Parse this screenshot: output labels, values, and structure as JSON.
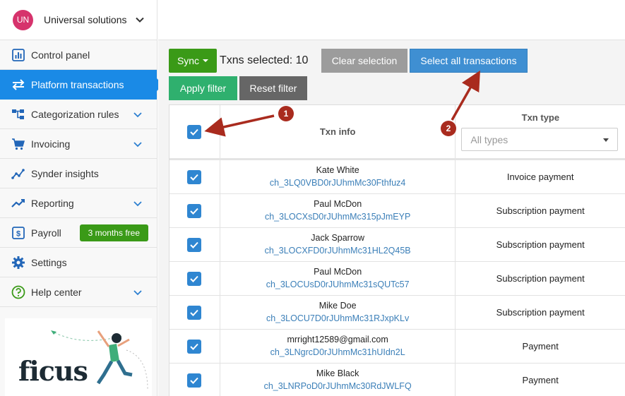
{
  "org": {
    "initials": "UN",
    "name": "Universal solutions"
  },
  "sidebar": {
    "items": [
      {
        "label": "Control panel",
        "icon": "bar-chart-icon",
        "has_chevron": false
      },
      {
        "label": "Platform transactions",
        "icon": "transfer-arrows-icon",
        "has_chevron": false,
        "active": true
      },
      {
        "label": "Categorization rules",
        "icon": "hierarchy-icon",
        "has_chevron": true
      },
      {
        "label": "Invoicing",
        "icon": "cart-icon",
        "has_chevron": true
      },
      {
        "label": "Synder insights",
        "icon": "insights-icon",
        "has_chevron": false
      },
      {
        "label": "Reporting",
        "icon": "trend-line-icon",
        "has_chevron": true
      },
      {
        "label": "Payroll",
        "icon": "dollar-icon",
        "has_chevron": false,
        "badge": "3 months free"
      },
      {
        "label": "Settings",
        "icon": "gear-icon",
        "has_chevron": false
      },
      {
        "label": "Help center",
        "icon": "question-icon",
        "has_chevron": true
      }
    ],
    "promo": {
      "logo_text": "ficus"
    }
  },
  "toolbar": {
    "sync_label": "Sync",
    "selected_text": "Txns selected: 10",
    "clear_label": "Clear selection",
    "select_all_label": "Select all transactions",
    "apply_label": "Apply filter",
    "reset_label": "Reset filter"
  },
  "table": {
    "col_info": "Txn info",
    "col_type": "Txn type",
    "type_filter_placeholder": "All types",
    "rows": [
      {
        "name": "Kate White",
        "id": "ch_3LQ0VBD0rJUhmMc30Fthfuz4",
        "type": "Invoice payment",
        "checked": true
      },
      {
        "name": "Paul McDon",
        "id": "ch_3LOCXsD0rJUhmMc315pJmEYP",
        "type": "Subscription payment",
        "checked": true
      },
      {
        "name": "Jack Sparrow",
        "id": "ch_3LOCXFD0rJUhmMc31HL2Q45B",
        "type": "Subscription payment",
        "checked": true
      },
      {
        "name": "Paul McDon",
        "id": "ch_3LOCUsD0rJUhmMc31sQUTc57",
        "type": "Subscription payment",
        "checked": true
      },
      {
        "name": "Mike Doe",
        "id": "ch_3LOCU7D0rJUhmMc31RJxpKLv",
        "type": "Subscription payment",
        "checked": true
      },
      {
        "name": "mrright12589@gmail.com",
        "id": "ch_3LNgrcD0rJUhmMc31hUIdn2L",
        "type": "Payment",
        "checked": true
      },
      {
        "name": "Mike Black",
        "id": "ch_3LNRPoD0rJUhmMc30RdJWLFQ",
        "type": "Payment",
        "checked": true
      }
    ]
  },
  "annotations": [
    {
      "number": "1"
    },
    {
      "number": "2"
    }
  ],
  "colors": {
    "accent": "#1a8ae6",
    "sync_green": "#3a9a17",
    "annotation": "#a92b1e"
  }
}
